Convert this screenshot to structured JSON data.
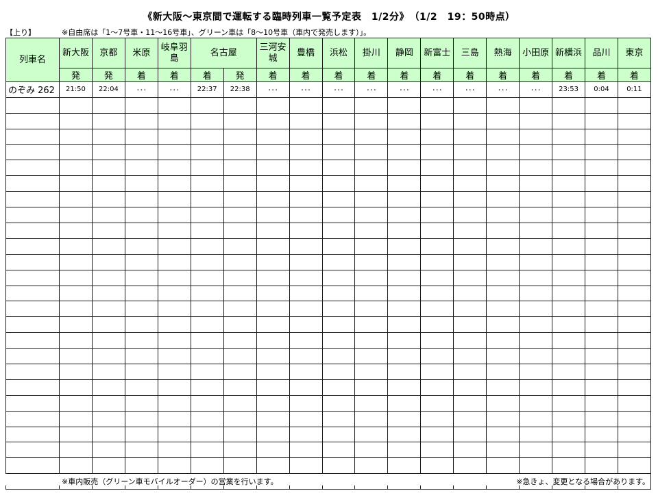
{
  "title": "《新大阪～東京間で運転する臨時列車一覧予定表　1/2分》　（1/2　19：50時点）",
  "direction": "【上り】",
  "note_top": "※自由席は「1～7号車・11～16号車」、グリーン車は「8～10号車（車内で発売します）」。",
  "header_train_name": "列車名",
  "stations": [
    {
      "name": "新大阪",
      "cols": [
        "発"
      ]
    },
    {
      "name": "京都",
      "cols": [
        "発"
      ]
    },
    {
      "name": "米原",
      "cols": [
        "着"
      ]
    },
    {
      "name": "岐阜羽島",
      "cols": [
        "着"
      ]
    },
    {
      "name": "名古屋",
      "cols": [
        "着",
        "発"
      ]
    },
    {
      "name": "三河安城",
      "cols": [
        "着"
      ]
    },
    {
      "name": "豊橋",
      "cols": [
        "着"
      ]
    },
    {
      "name": "浜松",
      "cols": [
        "着"
      ]
    },
    {
      "name": "掛川",
      "cols": [
        "着"
      ]
    },
    {
      "name": "静岡",
      "cols": [
        "着"
      ]
    },
    {
      "name": "新富士",
      "cols": [
        "着"
      ]
    },
    {
      "name": "三島",
      "cols": [
        "着"
      ]
    },
    {
      "name": "熱海",
      "cols": [
        "着"
      ]
    },
    {
      "name": "小田原",
      "cols": [
        "着"
      ]
    },
    {
      "name": "新横浜",
      "cols": [
        "着"
      ]
    },
    {
      "name": "品川",
      "cols": [
        "着"
      ]
    },
    {
      "name": "東京",
      "cols": [
        "着"
      ]
    }
  ],
  "trains": [
    {
      "name": "のぞみ 262",
      "times": [
        "21:50",
        "22:04",
        "･･･",
        "･･･",
        "22:37",
        "22:38",
        "･･･",
        "･･･",
        "･･･",
        "･･･",
        "･･･",
        "･･･",
        "･･･",
        "･･･",
        "･･･",
        "23:53",
        "0:04",
        "0:11"
      ]
    }
  ],
  "empty_rows": 25,
  "footer_left": "※車内販売（グリーン車モバイルオーダー）の営業を行います。",
  "footer_right": "※急きょ、変更となる場合があります。"
}
